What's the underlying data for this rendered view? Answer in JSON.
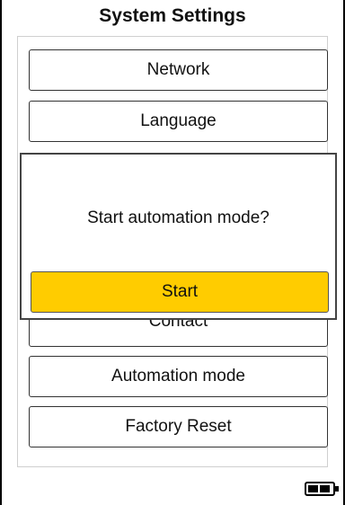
{
  "header": {
    "title": "System Settings"
  },
  "menu": {
    "items": [
      {
        "label": "Network"
      },
      {
        "label": "Language"
      },
      {
        "label": "Contact"
      },
      {
        "label": "Automation mode"
      },
      {
        "label": "Factory Reset"
      }
    ]
  },
  "dialog": {
    "message": "Start automation mode?",
    "confirm_label": "Start",
    "confirm_color": "#ffcc00"
  },
  "status": {
    "battery_icon": "battery-icon"
  }
}
